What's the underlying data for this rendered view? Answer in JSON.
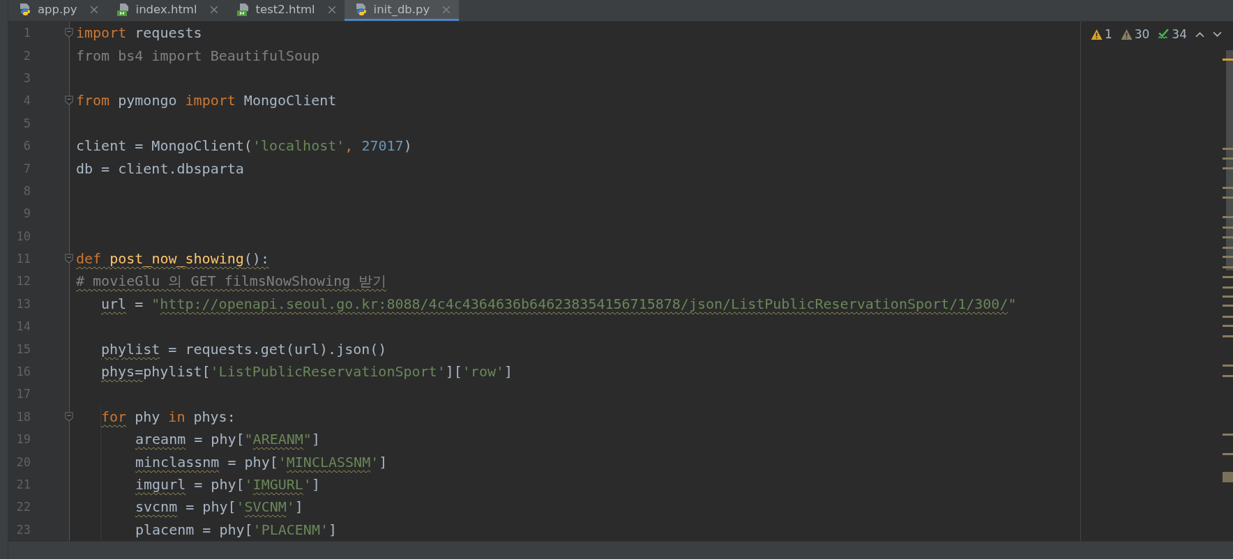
{
  "tabs": [
    {
      "label": "app.py",
      "kind": "python",
      "selected": false
    },
    {
      "label": "index.html",
      "kind": "html",
      "selected": false
    },
    {
      "label": "test2.html",
      "kind": "html",
      "selected": false
    },
    {
      "label": "init_db.py",
      "kind": "python",
      "selected": true
    }
  ],
  "inspections": [
    {
      "kind": "error",
      "count": "1"
    },
    {
      "kind": "warning",
      "count": "30"
    },
    {
      "kind": "typo",
      "count": "34"
    }
  ],
  "lines": [
    {
      "number": "1",
      "kind": "code",
      "fold": true,
      "tokens": [
        {
          "text": "import",
          "kind": "keyword",
          "squiggle": false
        },
        {
          "text": " requests",
          "kind": "plain",
          "squiggle": false
        }
      ]
    },
    {
      "number": "2",
      "kind": "code",
      "fold": false,
      "tokens": [
        {
          "text": "from bs4 import BeautifulSoup",
          "kind": "unused",
          "squiggle": false
        }
      ]
    },
    {
      "number": "3",
      "kind": "code",
      "fold": false
    },
    {
      "number": "4",
      "kind": "code",
      "fold": true,
      "tokens": [
        {
          "text": "from",
          "kind": "keyword",
          "squiggle": false
        },
        {
          "text": " pymongo ",
          "kind": "plain",
          "squiggle": false
        },
        {
          "text": "import",
          "kind": "keyword",
          "squiggle": false
        },
        {
          "text": " MongoClient",
          "kind": "plain",
          "squiggle": false
        }
      ]
    },
    {
      "number": "5",
      "kind": "code",
      "fold": false
    },
    {
      "number": "6",
      "kind": "code",
      "fold": false,
      "tokens": [
        {
          "text": "client = MongoClient(",
          "kind": "plain",
          "squiggle": false
        },
        {
          "text": "'localhost'",
          "kind": "string",
          "squiggle": false
        },
        {
          "text": ", ",
          "kind": "keyword",
          "squiggle": false
        },
        {
          "text": "27017",
          "kind": "number",
          "squiggle": false
        },
        {
          "text": ")",
          "kind": "plain",
          "squiggle": false
        }
      ]
    },
    {
      "number": "7",
      "kind": "code",
      "fold": false,
      "tokens": [
        {
          "text": "db = client.dbsparta",
          "kind": "plain",
          "squiggle": false
        }
      ]
    },
    {
      "number": "8",
      "kind": "code",
      "fold": false
    },
    {
      "number": "9",
      "kind": "code",
      "fold": false
    },
    {
      "number": "10",
      "kind": "code",
      "fold": false
    },
    {
      "number": "11",
      "kind": "code",
      "fold": true,
      "tokens": [
        {
          "text": "def ",
          "kind": "keyword",
          "squiggle": true
        },
        {
          "text": "post_now_showing",
          "kind": "function",
          "squiggle": true
        },
        {
          "text": "():",
          "kind": "plain",
          "squiggle": true
        }
      ],
      "children": [
        {
          "number": "12",
          "kind": "comment",
          "fold": false,
          "tokens": [
            {
              "text": "# movieGlu 의 GET filmsNowShowing 받기",
              "kind": "comment",
              "squiggle": true
            }
          ]
        },
        {
          "number": "13",
          "kind": "code",
          "fold": false,
          "tokens": [
            {
              "text": "url",
              "kind": "plain",
              "squiggle": true
            },
            {
              "text": " = ",
              "kind": "plain",
              "squiggle": false
            },
            {
              "text": "\"",
              "kind": "string",
              "squiggle": false
            },
            {
              "text": "http://openapi.seoul.go.kr:8088/4c4c4364636b646238354156715878/json/ListPublicReservationSport/1/300/",
              "kind": "string",
              "squiggle": true
            },
            {
              "text": "\"",
              "kind": "string",
              "squiggle": false
            }
          ]
        },
        {
          "number": "14",
          "kind": "code",
          "fold": false
        },
        {
          "number": "15",
          "kind": "code",
          "fold": false,
          "tokens": [
            {
              "text": "phylist",
              "kind": "plain",
              "squiggle": true
            },
            {
              "text": " = requests.get(url).json()",
              "kind": "plain",
              "squiggle": false
            }
          ]
        },
        {
          "number": "16",
          "kind": "code",
          "fold": false,
          "tokens": [
            {
              "text": "phys=",
              "kind": "plain",
              "squiggle": true
            },
            {
              "text": "phylist[",
              "kind": "plain",
              "squiggle": false
            },
            {
              "text": "'ListPublicReservationSport'",
              "kind": "string",
              "squiggle": false
            },
            {
              "text": "][",
              "kind": "plain",
              "squiggle": false
            },
            {
              "text": "'row'",
              "kind": "string",
              "squiggle": false
            },
            {
              "text": "]",
              "kind": "plain",
              "squiggle": false
            }
          ]
        },
        {
          "number": "17",
          "kind": "code",
          "fold": false
        },
        {
          "number": "18",
          "kind": "code",
          "fold": true,
          "tokens": [
            {
              "text": "for",
              "kind": "keyword",
              "squiggle": true
            },
            {
              "text": " phy ",
              "kind": "plain",
              "squiggle": false
            },
            {
              "text": "in",
              "kind": "keyword",
              "squiggle": false
            },
            {
              "text": " phys:",
              "kind": "plain",
              "squiggle": false
            }
          ],
          "children": [
            {
              "number": "19",
              "kind": "code",
              "fold": false,
              "tokens": [
                {
                  "text": "areanm",
                  "kind": "plain",
                  "squiggle": true
                },
                {
                  "text": " = phy[",
                  "kind": "plain",
                  "squiggle": false
                },
                {
                  "text": "\"",
                  "kind": "string",
                  "squiggle": false
                },
                {
                  "text": "AREANM",
                  "kind": "string",
                  "squiggle": true
                },
                {
                  "text": "\"",
                  "kind": "string",
                  "squiggle": false
                },
                {
                  "text": "]",
                  "kind": "plain",
                  "squiggle": false
                }
              ]
            },
            {
              "number": "20",
              "kind": "code",
              "fold": false,
              "tokens": [
                {
                  "text": "minclassnm",
                  "kind": "plain",
                  "squiggle": true
                },
                {
                  "text": " = phy[",
                  "kind": "plain",
                  "squiggle": false
                },
                {
                  "text": "'",
                  "kind": "string",
                  "squiggle": false
                },
                {
                  "text": "MINCLASSNM",
                  "kind": "string",
                  "squiggle": true
                },
                {
                  "text": "'",
                  "kind": "string",
                  "squiggle": false
                },
                {
                  "text": "]",
                  "kind": "plain",
                  "squiggle": false
                }
              ]
            },
            {
              "number": "21",
              "kind": "code",
              "fold": false,
              "tokens": [
                {
                  "text": "imgurl",
                  "kind": "plain",
                  "squiggle": true
                },
                {
                  "text": " = phy[",
                  "kind": "plain",
                  "squiggle": false
                },
                {
                  "text": "'",
                  "kind": "string",
                  "squiggle": false
                },
                {
                  "text": "IMGURL",
                  "kind": "string",
                  "squiggle": true
                },
                {
                  "text": "'",
                  "kind": "string",
                  "squiggle": false
                },
                {
                  "text": "]",
                  "kind": "plain",
                  "squiggle": false
                }
              ]
            },
            {
              "number": "22",
              "kind": "code",
              "fold": false,
              "tokens": [
                {
                  "text": "svcnm",
                  "kind": "plain",
                  "squiggle": true
                },
                {
                  "text": " = phy[",
                  "kind": "plain",
                  "squiggle": false
                },
                {
                  "text": "'",
                  "kind": "string",
                  "squiggle": false
                },
                {
                  "text": "SVCNM",
                  "kind": "string",
                  "squiggle": true
                },
                {
                  "text": "'",
                  "kind": "string",
                  "squiggle": false
                },
                {
                  "text": "]",
                  "kind": "plain",
                  "squiggle": false
                }
              ]
            },
            {
              "number": "23",
              "kind": "code",
              "fold": false,
              "tokens": [
                {
                  "text": "placenm",
                  "kind": "plain",
                  "squiggle": false
                },
                {
                  "text": " = phy[",
                  "kind": "plain",
                  "squiggle": false
                },
                {
                  "text": "'PLACENM'",
                  "kind": "string",
                  "squiggle": false
                },
                {
                  "text": "]",
                  "kind": "plain",
                  "squiggle": false
                }
              ]
            }
          ]
        }
      ]
    }
  ]
}
